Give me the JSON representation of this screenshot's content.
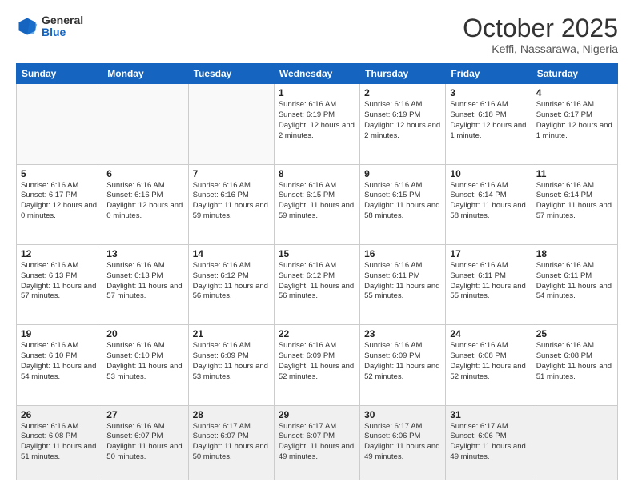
{
  "header": {
    "logo_general": "General",
    "logo_blue": "Blue",
    "month": "October 2025",
    "location": "Keffi, Nassarawa, Nigeria"
  },
  "days_of_week": [
    "Sunday",
    "Monday",
    "Tuesday",
    "Wednesday",
    "Thursday",
    "Friday",
    "Saturday"
  ],
  "weeks": [
    [
      {
        "day": "",
        "info": ""
      },
      {
        "day": "",
        "info": ""
      },
      {
        "day": "",
        "info": ""
      },
      {
        "day": "1",
        "info": "Sunrise: 6:16 AM\nSunset: 6:19 PM\nDaylight: 12 hours and 2 minutes."
      },
      {
        "day": "2",
        "info": "Sunrise: 6:16 AM\nSunset: 6:19 PM\nDaylight: 12 hours and 2 minutes."
      },
      {
        "day": "3",
        "info": "Sunrise: 6:16 AM\nSunset: 6:18 PM\nDaylight: 12 hours and 1 minute."
      },
      {
        "day": "4",
        "info": "Sunrise: 6:16 AM\nSunset: 6:17 PM\nDaylight: 12 hours and 1 minute."
      }
    ],
    [
      {
        "day": "5",
        "info": "Sunrise: 6:16 AM\nSunset: 6:17 PM\nDaylight: 12 hours and 0 minutes."
      },
      {
        "day": "6",
        "info": "Sunrise: 6:16 AM\nSunset: 6:16 PM\nDaylight: 12 hours and 0 minutes."
      },
      {
        "day": "7",
        "info": "Sunrise: 6:16 AM\nSunset: 6:16 PM\nDaylight: 11 hours and 59 minutes."
      },
      {
        "day": "8",
        "info": "Sunrise: 6:16 AM\nSunset: 6:15 PM\nDaylight: 11 hours and 59 minutes."
      },
      {
        "day": "9",
        "info": "Sunrise: 6:16 AM\nSunset: 6:15 PM\nDaylight: 11 hours and 58 minutes."
      },
      {
        "day": "10",
        "info": "Sunrise: 6:16 AM\nSunset: 6:14 PM\nDaylight: 11 hours and 58 minutes."
      },
      {
        "day": "11",
        "info": "Sunrise: 6:16 AM\nSunset: 6:14 PM\nDaylight: 11 hours and 57 minutes."
      }
    ],
    [
      {
        "day": "12",
        "info": "Sunrise: 6:16 AM\nSunset: 6:13 PM\nDaylight: 11 hours and 57 minutes."
      },
      {
        "day": "13",
        "info": "Sunrise: 6:16 AM\nSunset: 6:13 PM\nDaylight: 11 hours and 57 minutes."
      },
      {
        "day": "14",
        "info": "Sunrise: 6:16 AM\nSunset: 6:12 PM\nDaylight: 11 hours and 56 minutes."
      },
      {
        "day": "15",
        "info": "Sunrise: 6:16 AM\nSunset: 6:12 PM\nDaylight: 11 hours and 56 minutes."
      },
      {
        "day": "16",
        "info": "Sunrise: 6:16 AM\nSunset: 6:11 PM\nDaylight: 11 hours and 55 minutes."
      },
      {
        "day": "17",
        "info": "Sunrise: 6:16 AM\nSunset: 6:11 PM\nDaylight: 11 hours and 55 minutes."
      },
      {
        "day": "18",
        "info": "Sunrise: 6:16 AM\nSunset: 6:11 PM\nDaylight: 11 hours and 54 minutes."
      }
    ],
    [
      {
        "day": "19",
        "info": "Sunrise: 6:16 AM\nSunset: 6:10 PM\nDaylight: 11 hours and 54 minutes."
      },
      {
        "day": "20",
        "info": "Sunrise: 6:16 AM\nSunset: 6:10 PM\nDaylight: 11 hours and 53 minutes."
      },
      {
        "day": "21",
        "info": "Sunrise: 6:16 AM\nSunset: 6:09 PM\nDaylight: 11 hours and 53 minutes."
      },
      {
        "day": "22",
        "info": "Sunrise: 6:16 AM\nSunset: 6:09 PM\nDaylight: 11 hours and 52 minutes."
      },
      {
        "day": "23",
        "info": "Sunrise: 6:16 AM\nSunset: 6:09 PM\nDaylight: 11 hours and 52 minutes."
      },
      {
        "day": "24",
        "info": "Sunrise: 6:16 AM\nSunset: 6:08 PM\nDaylight: 11 hours and 52 minutes."
      },
      {
        "day": "25",
        "info": "Sunrise: 6:16 AM\nSunset: 6:08 PM\nDaylight: 11 hours and 51 minutes."
      }
    ],
    [
      {
        "day": "26",
        "info": "Sunrise: 6:16 AM\nSunset: 6:08 PM\nDaylight: 11 hours and 51 minutes."
      },
      {
        "day": "27",
        "info": "Sunrise: 6:16 AM\nSunset: 6:07 PM\nDaylight: 11 hours and 50 minutes."
      },
      {
        "day": "28",
        "info": "Sunrise: 6:17 AM\nSunset: 6:07 PM\nDaylight: 11 hours and 50 minutes."
      },
      {
        "day": "29",
        "info": "Sunrise: 6:17 AM\nSunset: 6:07 PM\nDaylight: 11 hours and 49 minutes."
      },
      {
        "day": "30",
        "info": "Sunrise: 6:17 AM\nSunset: 6:06 PM\nDaylight: 11 hours and 49 minutes."
      },
      {
        "day": "31",
        "info": "Sunrise: 6:17 AM\nSunset: 6:06 PM\nDaylight: 11 hours and 49 minutes."
      },
      {
        "day": "",
        "info": ""
      }
    ]
  ]
}
